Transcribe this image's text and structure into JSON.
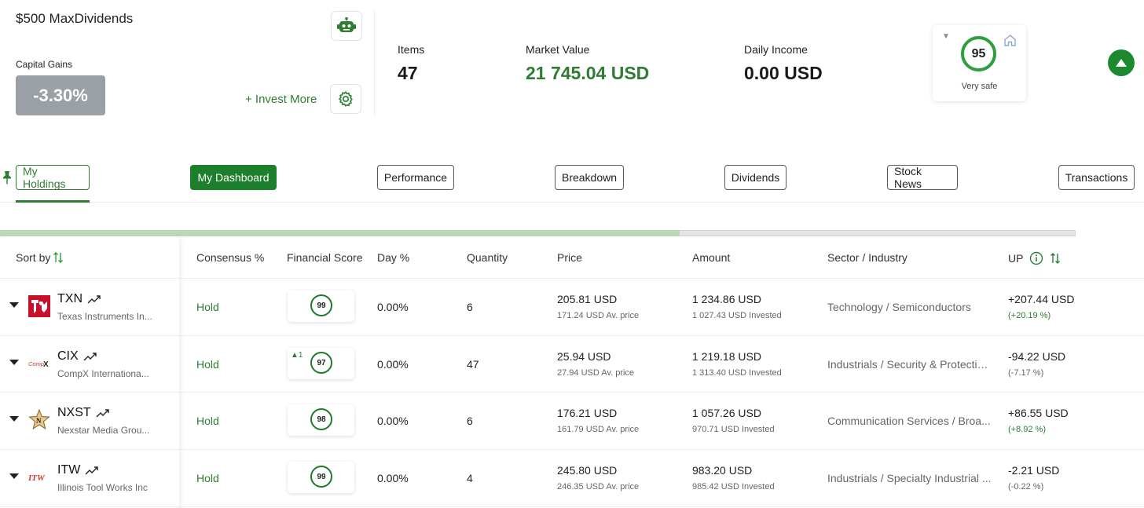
{
  "portfolio": {
    "title": "$500 MaxDividends",
    "capital_gains_label": "Capital Gains",
    "capital_gains_value": "-3.30%",
    "invest_more": "+ Invest More"
  },
  "stats": {
    "items_label": "Items",
    "items_value": "47",
    "market_value_label": "Market Value",
    "market_value": "21 745.04 USD",
    "daily_income_label": "Daily Income",
    "daily_income": "0.00 USD"
  },
  "safety": {
    "score": "95",
    "label": "Very safe"
  },
  "tabs": [
    {
      "label": "My Holdings"
    },
    {
      "label": "My Dashboard"
    },
    {
      "label": "Performance"
    },
    {
      "label": "Breakdown"
    },
    {
      "label": "Dividends"
    },
    {
      "label": "Stock News"
    },
    {
      "label": "Transactions"
    }
  ],
  "progress": {
    "fraction": 0.632
  },
  "table": {
    "headers": {
      "sort_by": "Sort by",
      "consensus": "Consensus %",
      "financial_score": "Financial Score",
      "day": "Day %",
      "quantity": "Quantity",
      "price": "Price",
      "amount": "Amount",
      "sector": "Sector / Industry",
      "up": "UP"
    },
    "rows": [
      {
        "ticker": "TXN",
        "company": "Texas Instruments In...",
        "logo": "texas-instruments",
        "consensus": "Hold",
        "score": "99",
        "score_delta": "",
        "day": "0.00%",
        "quantity": "6",
        "price": "205.81 USD",
        "avg_price": "171.24 USD Av. price",
        "amount": "1 234.86 USD",
        "invested": "1 027.43 USD Invested",
        "sector": "Technology / Semiconductors",
        "up": "+207.44 USD",
        "up_pct": "(+20.19 %)"
      },
      {
        "ticker": "CIX",
        "company": "CompX Internationa...",
        "logo": "compx",
        "consensus": "Hold",
        "score": "97",
        "score_delta": "▲1",
        "day": "0.00%",
        "quantity": "47",
        "price": "25.94 USD",
        "avg_price": "27.94 USD Av. price",
        "amount": "1 219.18 USD",
        "invested": "1 313.40 USD Invested",
        "sector": "Industrials / Security & Protection...",
        "up": "-94.22 USD",
        "up_pct": "(-7.17 %)"
      },
      {
        "ticker": "NXST",
        "company": "Nexstar Media Grou...",
        "logo": "nexstar",
        "consensus": "Hold",
        "score": "98",
        "score_delta": "",
        "day": "0.00%",
        "quantity": "6",
        "price": "176.21 USD",
        "avg_price": "161.79 USD Av. price",
        "amount": "1 057.26 USD",
        "invested": "970.71 USD Invested",
        "sector": "Communication Services / Broa...",
        "up": "+86.55 USD",
        "up_pct": "(+8.92 %)"
      },
      {
        "ticker": "ITW",
        "company": "Illinois Tool Works Inc",
        "logo": "itw",
        "consensus": "Hold",
        "score": "99",
        "score_delta": "",
        "day": "0.00%",
        "quantity": "4",
        "price": "245.80 USD",
        "avg_price": "246.35 USD Av. price",
        "amount": "983.20 USD",
        "invested": "985.42 USD Invested",
        "sector": "Industrials / Specialty Industrial ...",
        "up": "-2.21 USD",
        "up_pct": "(-0.22 %)"
      }
    ]
  },
  "colors": {
    "brand_green": "#1b7f2c",
    "positive": "#2e7d32",
    "neutral_badge": "#9aa0a6"
  }
}
